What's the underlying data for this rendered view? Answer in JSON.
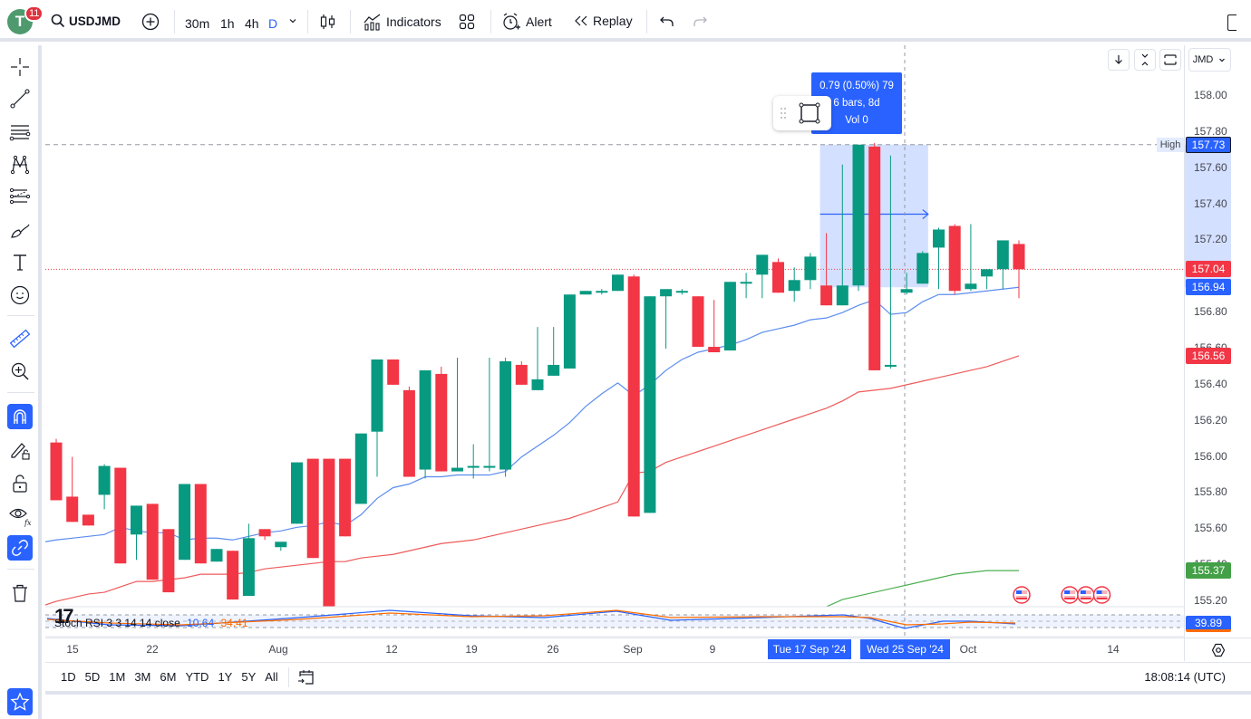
{
  "topbar": {
    "avatar_letter": "T",
    "notification_count": "11",
    "symbol": "USDJMD",
    "intervals": [
      "30m",
      "1h",
      "4h",
      "D"
    ],
    "active_interval": "D",
    "indicators_label": "Indicators",
    "alert_label": "Alert",
    "replay_label": "Replay"
  },
  "left_toolbar": {
    "tools": [
      "crosshair",
      "trend-line",
      "fib-retracement",
      "pattern",
      "forecast-tools",
      "brush",
      "text",
      "emoji",
      "ruler",
      "zoom-in",
      "magnet",
      "lock-drawings",
      "lock",
      "hide",
      "sync-link",
      "trash",
      "watchlist-star"
    ]
  },
  "chart_controls": {
    "currency": "JMD",
    "high_label": "High"
  },
  "measure_tooltip": {
    "line1": "0.79 (0.50%) 79",
    "line2": "6 bars, 8d",
    "line3": "Vol 0"
  },
  "stoch_rsi": {
    "label": "Stoch RSI 3 3 14 14 close",
    "k_value": "10.64",
    "d_value": "34.41",
    "axis_value": "39.89",
    "k_color": "#2962ff",
    "d_color": "#ff6d00"
  },
  "bottombar": {
    "ranges": [
      "1D",
      "5D",
      "1M",
      "3M",
      "6M",
      "YTD",
      "1Y",
      "5Y",
      "All"
    ],
    "clock": "18:08:14 (UTC)"
  },
  "chart_data": {
    "type": "candlestick",
    "symbol": "USDJMD",
    "interval": "D",
    "price_axis_ticks": [
      "158.00",
      "157.80",
      "157.60",
      "157.40",
      "157.20",
      "156.80",
      "156.60",
      "156.40",
      "156.20",
      "156.00",
      "155.80",
      "155.60",
      "155.40",
      "155.20"
    ],
    "ylim": [
      155.15,
      158.2
    ],
    "price_tags": [
      {
        "label": "157.73",
        "kind": "high",
        "color": "#2962ff"
      },
      {
        "label": "157.04",
        "kind": "last-price",
        "color": "#f23645"
      },
      {
        "label": "156.94",
        "kind": "ma-fast",
        "color": "#2962ff"
      },
      {
        "label": "156.56",
        "kind": "ma-slow",
        "color": "#f23645"
      },
      {
        "label": "155.37",
        "kind": "ma-long",
        "color": "#43a047"
      }
    ],
    "time_axis_labels": [
      "15",
      "22",
      "Aug",
      "12",
      "19",
      "26",
      "Sep",
      "9",
      "Tue 17 Sep '24",
      "Wed 25 Sep '24",
      "Oct",
      "14"
    ],
    "colors": {
      "up": "#089981",
      "down": "#f23645",
      "ma_fast": "#5b8def",
      "ma_slow": "#ef5a5a",
      "ma_long": "#4caf50"
    },
    "candles": [
      {
        "o": 156.08,
        "h": 156.1,
        "l": 155.76,
        "c": 155.76
      },
      {
        "o": 155.78,
        "h": 156.0,
        "l": 155.64,
        "c": 155.64
      },
      {
        "o": 155.68,
        "h": 155.68,
        "l": 155.62,
        "c": 155.62
      },
      {
        "o": 155.79,
        "h": 155.96,
        "l": 155.71,
        "c": 155.95
      },
      {
        "o": 155.94,
        "h": 155.94,
        "l": 155.41,
        "c": 155.41
      },
      {
        "o": 155.57,
        "h": 155.73,
        "l": 155.43,
        "c": 155.73
      },
      {
        "o": 155.74,
        "h": 155.74,
        "l": 155.32,
        "c": 155.32
      },
      {
        "o": 155.6,
        "h": 155.6,
        "l": 155.25,
        "c": 155.25
      },
      {
        "o": 155.43,
        "h": 155.85,
        "l": 155.43,
        "c": 155.85
      },
      {
        "o": 155.85,
        "h": 155.85,
        "l": 155.41,
        "c": 155.41
      },
      {
        "o": 155.42,
        "h": 155.49,
        "l": 155.42,
        "c": 155.49
      },
      {
        "o": 155.48,
        "h": 155.48,
        "l": 155.21,
        "c": 155.21
      },
      {
        "o": 155.23,
        "h": 155.63,
        "l": 155.23,
        "c": 155.55
      },
      {
        "o": 155.6,
        "h": 155.6,
        "l": 155.54,
        "c": 155.56
      },
      {
        "o": 155.5,
        "h": 155.5,
        "l": 155.48,
        "c": 155.53
      },
      {
        "o": 155.63,
        "h": 155.97,
        "l": 155.63,
        "c": 155.97
      },
      {
        "o": 155.99,
        "h": 155.99,
        "l": 155.44,
        "c": 155.44
      },
      {
        "o": 155.99,
        "h": 155.99,
        "l": 155.15,
        "c": 155.15
      },
      {
        "o": 155.99,
        "h": 155.99,
        "l": 155.56,
        "c": 155.56
      },
      {
        "o": 155.74,
        "h": 156.13,
        "l": 155.74,
        "c": 156.13
      },
      {
        "o": 156.14,
        "h": 156.54,
        "l": 155.89,
        "c": 156.54
      },
      {
        "o": 156.54,
        "h": 156.54,
        "l": 156.4,
        "c": 156.4
      },
      {
        "o": 156.37,
        "h": 156.39,
        "l": 155.89,
        "c": 155.89
      },
      {
        "o": 155.93,
        "h": 156.48,
        "l": 155.88,
        "c": 156.48
      },
      {
        "o": 156.46,
        "h": 156.5,
        "l": 155.92,
        "c": 155.92
      },
      {
        "o": 155.92,
        "h": 156.55,
        "l": 155.92,
        "c": 155.94
      },
      {
        "o": 155.94,
        "h": 156.07,
        "l": 155.88,
        "c": 155.95
      },
      {
        "o": 155.95,
        "h": 156.55,
        "l": 155.92,
        "c": 155.95
      },
      {
        "o": 155.93,
        "h": 156.55,
        "l": 155.89,
        "c": 156.53
      },
      {
        "o": 156.51,
        "h": 156.53,
        "l": 156.4,
        "c": 156.4
      },
      {
        "o": 156.37,
        "h": 156.72,
        "l": 156.37,
        "c": 156.43
      },
      {
        "o": 156.45,
        "h": 156.72,
        "l": 156.45,
        "c": 156.51
      },
      {
        "o": 156.49,
        "h": 156.9,
        "l": 156.49,
        "c": 156.9
      },
      {
        "o": 156.9,
        "h": 156.92,
        "l": 156.9,
        "c": 156.92
      },
      {
        "o": 156.91,
        "h": 156.93,
        "l": 156.9,
        "c": 156.92
      },
      {
        "o": 156.92,
        "h": 157.01,
        "l": 156.92,
        "c": 157.01
      },
      {
        "o": 157.0,
        "h": 157.01,
        "l": 155.67,
        "c": 155.67
      },
      {
        "o": 155.69,
        "h": 156.89,
        "l": 155.69,
        "c": 156.89
      },
      {
        "o": 156.89,
        "h": 156.91,
        "l": 156.6,
        "c": 156.93
      },
      {
        "o": 156.92,
        "h": 156.93,
        "l": 156.9,
        "c": 156.92
      },
      {
        "o": 156.89,
        "h": 156.89,
        "l": 156.61,
        "c": 156.61
      },
      {
        "o": 156.61,
        "h": 156.87,
        "l": 156.58,
        "c": 156.58
      },
      {
        "o": 156.59,
        "h": 156.97,
        "l": 156.59,
        "c": 156.97
      },
      {
        "o": 156.97,
        "h": 157.02,
        "l": 156.88,
        "c": 156.97
      },
      {
        "o": 157.01,
        "h": 157.12,
        "l": 156.88,
        "c": 157.12
      },
      {
        "o": 157.08,
        "h": 157.1,
        "l": 156.91,
        "c": 156.91
      },
      {
        "o": 156.92,
        "h": 157.05,
        "l": 156.86,
        "c": 156.98
      },
      {
        "o": 156.98,
        "h": 157.13,
        "l": 156.93,
        "c": 157.11
      },
      {
        "o": 156.95,
        "h": 157.24,
        "l": 156.84,
        "c": 156.84
      },
      {
        "o": 156.84,
        "h": 157.62,
        "l": 156.84,
        "c": 156.95
      },
      {
        "o": 156.95,
        "h": 157.73,
        "l": 156.92,
        "c": 157.73
      },
      {
        "o": 157.72,
        "h": 157.74,
        "l": 156.48,
        "c": 156.48
      },
      {
        "o": 156.5,
        "h": 157.67,
        "l": 156.49,
        "c": 156.51
      },
      {
        "o": 156.91,
        "h": 157.02,
        "l": 156.9,
        "c": 156.93
      },
      {
        "o": 156.96,
        "h": 157.14,
        "l": 156.96,
        "c": 157.13
      },
      {
        "o": 157.16,
        "h": 157.27,
        "l": 156.93,
        "c": 157.26
      },
      {
        "o": 157.28,
        "h": 157.29,
        "l": 156.9,
        "c": 156.92
      },
      {
        "o": 156.93,
        "h": 157.29,
        "l": 156.92,
        "c": 156.96
      },
      {
        "o": 157.0,
        "h": 157.04,
        "l": 156.93,
        "c": 157.04
      },
      {
        "o": 157.04,
        "h": 157.2,
        "l": 156.93,
        "c": 157.2
      },
      {
        "o": 157.18,
        "h": 157.2,
        "l": 156.88,
        "c": 157.04
      }
    ],
    "ma_fast": [
      155.54,
      155.55,
      155.56,
      155.57,
      155.61,
      155.59,
      155.58,
      155.58,
      155.54,
      155.55,
      155.55,
      155.54,
      155.56,
      155.58,
      155.59,
      155.61,
      155.62,
      155.64,
      155.62,
      155.68,
      155.77,
      155.83,
      155.85,
      155.89,
      155.89,
      155.9,
      155.9,
      155.9,
      155.92,
      156.0,
      156.06,
      156.12,
      156.19,
      156.28,
      156.35,
      156.41,
      156.34,
      156.4,
      156.48,
      156.54,
      156.58,
      156.6,
      156.62,
      156.65,
      156.69,
      156.71,
      156.73,
      156.76,
      156.77,
      156.8,
      156.84,
      156.87,
      156.79,
      156.8,
      156.86,
      156.9,
      156.9,
      156.91,
      156.92,
      156.93,
      156.94
    ],
    "ma_slow_start_index": 0,
    "ma_slow": [
      155.2,
      155.22,
      155.24,
      155.25,
      155.28,
      155.31,
      155.31,
      155.32,
      155.33,
      155.35,
      155.35,
      155.35,
      155.36,
      155.38,
      155.39,
      155.4,
      155.41,
      155.42,
      155.42,
      155.44,
      155.45,
      155.46,
      155.48,
      155.5,
      155.52,
      155.53,
      155.54,
      155.56,
      155.58,
      155.6,
      155.62,
      155.64,
      155.66,
      155.69,
      155.72,
      155.75,
      155.91,
      155.92,
      155.97,
      156.0,
      156.03,
      156.06,
      156.09,
      156.12,
      156.15,
      156.18,
      156.21,
      156.24,
      156.27,
      156.31,
      156.36,
      156.37,
      156.38,
      156.4,
      156.42,
      156.44,
      156.46,
      156.48,
      156.5,
      156.53,
      156.56
    ],
    "ma_long_start_index": 48,
    "ma_long": [
      155.17,
      155.21,
      155.23,
      155.25,
      155.27,
      155.29,
      155.31,
      155.33,
      155.35,
      155.36,
      155.37,
      155.37,
      155.37
    ],
    "event_markers": [
      {
        "index": 60,
        "icon": "us-flag-event"
      },
      {
        "index": 63,
        "icon": "us-flag-event"
      },
      {
        "index": 64,
        "icon": "us-flag-event"
      },
      {
        "index": 65,
        "icon": "us-flag-event"
      }
    ],
    "measure_range": {
      "start_index": 48,
      "end_index": 54,
      "from_price": 156.94,
      "to_price": 157.73,
      "change": "0.79 (0.50%) 79",
      "bars": "6 bars, 8d",
      "volume": "Vol 0"
    }
  }
}
